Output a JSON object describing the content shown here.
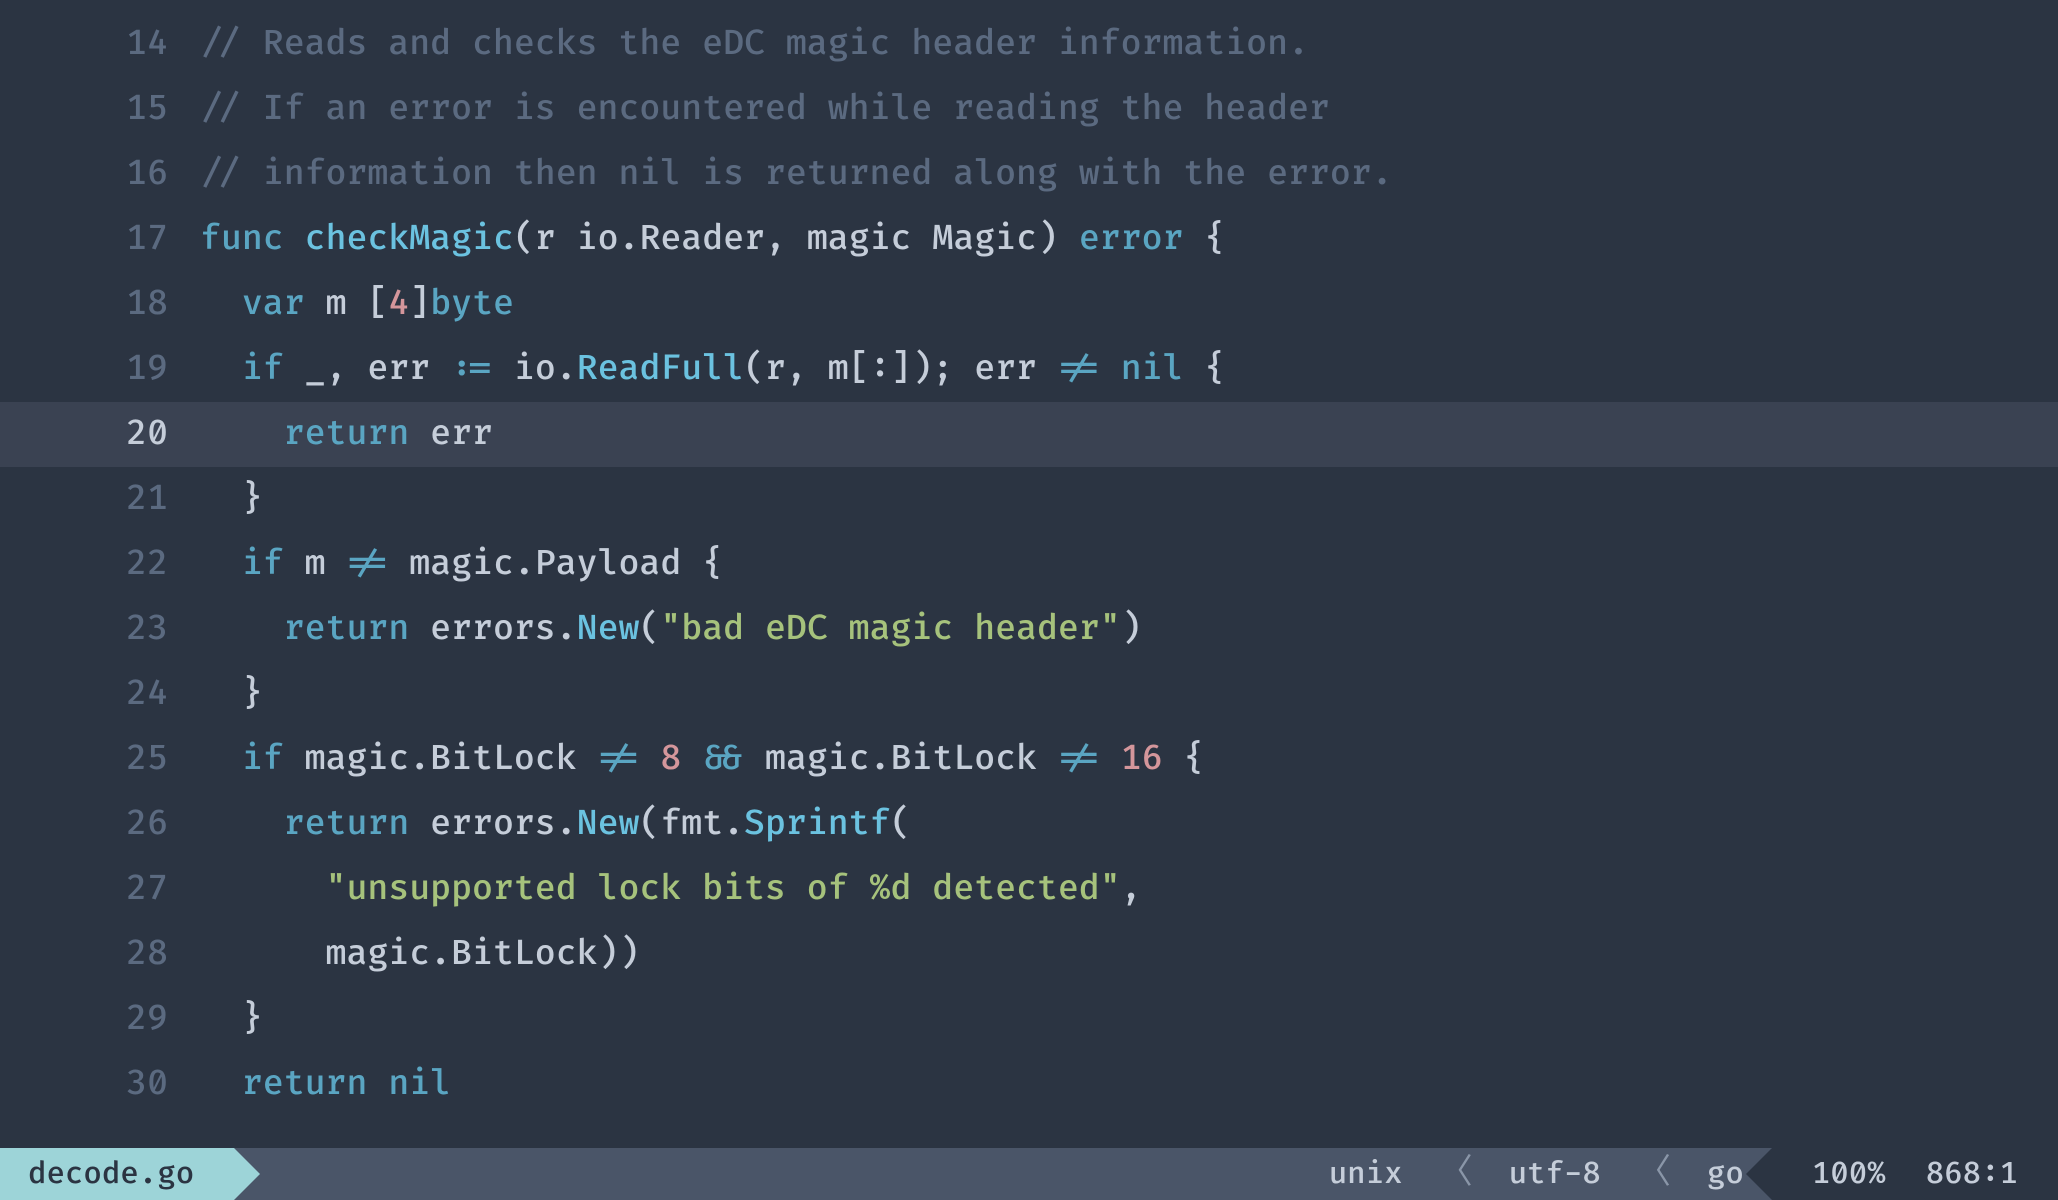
{
  "editor": {
    "startLine": 14,
    "activeLine": 20,
    "lines": [
      [
        {
          "c": "comment",
          "t": "// Reads and checks the eDC magic header information."
        }
      ],
      [
        {
          "c": "comment",
          "t": "// If an error is encountered while reading the header"
        }
      ],
      [
        {
          "c": "comment",
          "t": "// information then nil is returned along with the error."
        }
      ],
      [
        {
          "c": "keyword",
          "t": "func"
        },
        {
          "c": "ident",
          "t": " "
        },
        {
          "c": "func",
          "t": "checkMagic"
        },
        {
          "c": "punc",
          "t": "(r "
        },
        {
          "c": "ident",
          "t": "io"
        },
        {
          "c": "punc",
          "t": "."
        },
        {
          "c": "type",
          "t": "Reader"
        },
        {
          "c": "punc",
          "t": ", magic "
        },
        {
          "c": "type",
          "t": "Magic"
        },
        {
          "c": "punc",
          "t": ") "
        },
        {
          "c": "error",
          "t": "error"
        },
        {
          "c": "punc",
          "t": " {"
        }
      ],
      [
        {
          "c": "ident",
          "t": "  "
        },
        {
          "c": "keyword",
          "t": "var"
        },
        {
          "c": "ident",
          "t": " m "
        },
        {
          "c": "punc",
          "t": "["
        },
        {
          "c": "num",
          "t": "4"
        },
        {
          "c": "punc",
          "t": "]"
        },
        {
          "c": "builtin",
          "t": "byte"
        }
      ],
      [
        {
          "c": "ident",
          "t": "  "
        },
        {
          "c": "keyword",
          "t": "if"
        },
        {
          "c": "ident",
          "t": " _, err "
        },
        {
          "c": "op",
          "t": ":="
        },
        {
          "c": "ident",
          "t": " io."
        },
        {
          "c": "method",
          "t": "ReadFull"
        },
        {
          "c": "punc",
          "t": "(r, m[:]); err "
        },
        {
          "c": "op",
          "t": "!="
        },
        {
          "c": "ident",
          "t": " "
        },
        {
          "c": "keyword",
          "t": "nil"
        },
        {
          "c": "punc",
          "t": " {"
        }
      ],
      [
        {
          "c": "ident",
          "t": "    "
        },
        {
          "c": "keyword",
          "t": "return"
        },
        {
          "c": "ident",
          "t": " err"
        }
      ],
      [
        {
          "c": "ident",
          "t": "  "
        },
        {
          "c": "punc",
          "t": "}"
        }
      ],
      [
        {
          "c": "ident",
          "t": "  "
        },
        {
          "c": "keyword",
          "t": "if"
        },
        {
          "c": "ident",
          "t": " m "
        },
        {
          "c": "op",
          "t": "!="
        },
        {
          "c": "ident",
          "t": " magic.Payload "
        },
        {
          "c": "punc",
          "t": "{"
        }
      ],
      [
        {
          "c": "ident",
          "t": "    "
        },
        {
          "c": "keyword",
          "t": "return"
        },
        {
          "c": "ident",
          "t": " errors."
        },
        {
          "c": "method",
          "t": "New"
        },
        {
          "c": "punc",
          "t": "("
        },
        {
          "c": "string",
          "t": "\"bad eDC magic header\""
        },
        {
          "c": "punc",
          "t": ")"
        }
      ],
      [
        {
          "c": "ident",
          "t": "  "
        },
        {
          "c": "punc",
          "t": "}"
        }
      ],
      [
        {
          "c": "ident",
          "t": "  "
        },
        {
          "c": "keyword",
          "t": "if"
        },
        {
          "c": "ident",
          "t": " magic.BitLock "
        },
        {
          "c": "op",
          "t": "!="
        },
        {
          "c": "ident",
          "t": " "
        },
        {
          "c": "num",
          "t": "8"
        },
        {
          "c": "ident",
          "t": " "
        },
        {
          "c": "op",
          "t": "&&"
        },
        {
          "c": "ident",
          "t": " magic.BitLock "
        },
        {
          "c": "op",
          "t": "!="
        },
        {
          "c": "ident",
          "t": " "
        },
        {
          "c": "num",
          "t": "16"
        },
        {
          "c": "punc",
          "t": " {"
        }
      ],
      [
        {
          "c": "ident",
          "t": "    "
        },
        {
          "c": "keyword",
          "t": "return"
        },
        {
          "c": "ident",
          "t": " errors."
        },
        {
          "c": "method",
          "t": "New"
        },
        {
          "c": "punc",
          "t": "(fmt."
        },
        {
          "c": "method",
          "t": "Sprintf"
        },
        {
          "c": "punc",
          "t": "("
        }
      ],
      [
        {
          "c": "ident",
          "t": "      "
        },
        {
          "c": "string",
          "t": "\"unsupported lock bits of %d detected\""
        },
        {
          "c": "punc",
          "t": ","
        }
      ],
      [
        {
          "c": "ident",
          "t": "      magic.BitLock))"
        }
      ],
      [
        {
          "c": "ident",
          "t": "  "
        },
        {
          "c": "punc",
          "t": "}"
        }
      ],
      [
        {
          "c": "ident",
          "t": "  "
        },
        {
          "c": "keyword",
          "t": "return"
        },
        {
          "c": "ident",
          "t": " "
        },
        {
          "c": "keyword",
          "t": "nil"
        }
      ]
    ]
  },
  "statusbar": {
    "filename": "decode.go",
    "line_ending": "unix",
    "encoding": "utf-8",
    "filetype": "go",
    "percent": "100%",
    "position": "868:1"
  }
}
